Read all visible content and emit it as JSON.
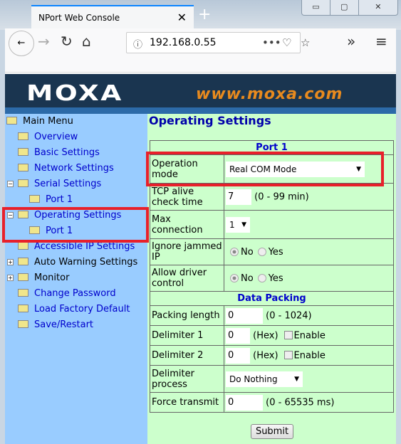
{
  "browser": {
    "tab_title": "NPort Web Console",
    "url": "192.168.0.55"
  },
  "banner": {
    "logo": "MOXA",
    "website": "www.moxa.com"
  },
  "menu": {
    "root": "Main Menu",
    "items": [
      {
        "label": "Overview"
      },
      {
        "label": "Basic Settings"
      },
      {
        "label": "Network Settings"
      },
      {
        "label": "Serial Settings",
        "expanded": true
      },
      {
        "label": "Port 1",
        "child": true
      },
      {
        "label": "Operating Settings",
        "expanded": true
      },
      {
        "label": "Port 1",
        "child": true
      },
      {
        "label": "Accessible IP Settings"
      },
      {
        "label": "Auto Warning Settings",
        "collapsed": true
      },
      {
        "label": "Monitor",
        "collapsed": true
      },
      {
        "label": "Change Password"
      },
      {
        "label": "Load Factory Default"
      },
      {
        "label": "Save/Restart"
      }
    ]
  },
  "main": {
    "title": "Operating Settings",
    "section1": "Port 1",
    "section2": "Data Packing",
    "operation_mode": {
      "label": "Operation mode",
      "value": "Real COM Mode"
    },
    "tcp_alive": {
      "label": "TCP alive check time",
      "value": "7",
      "hint": "(0 - 99 min)"
    },
    "max_connection": {
      "label": "Max connection",
      "value": "1"
    },
    "ignore_jammed": {
      "label": "Ignore jammed IP",
      "no": "No",
      "yes": "Yes",
      "selected": "No"
    },
    "allow_driver": {
      "label": "Allow driver control",
      "no": "No",
      "yes": "Yes",
      "selected": "No"
    },
    "packing_length": {
      "label": "Packing length",
      "value": "0",
      "hint": "(0 - 1024)"
    },
    "delimiter1": {
      "label": "Delimiter 1",
      "value": "0",
      "hint": "(Hex)",
      "enable": "Enable",
      "checked": false
    },
    "delimiter2": {
      "label": "Delimiter 2",
      "value": "0",
      "hint": "(Hex)",
      "enable": "Enable",
      "checked": false
    },
    "delimiter_process": {
      "label": "Delimiter process",
      "value": "Do Nothing"
    },
    "force_transmit": {
      "label": "Force transmit",
      "value": "0",
      "hint": "(0 - 65535 ms)"
    },
    "submit": "Submit"
  },
  "colors": {
    "sidebar": "#99ccff",
    "content": "#ccffcc",
    "highlight": "#e8202a",
    "link": "#0000cc"
  }
}
